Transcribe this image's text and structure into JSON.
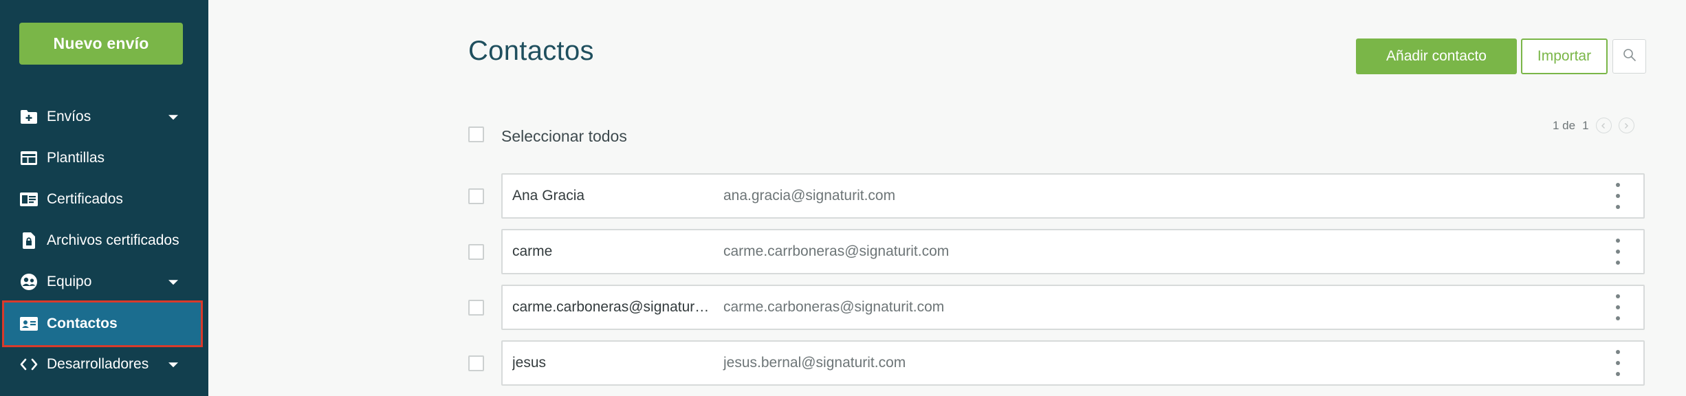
{
  "sidebar": {
    "new_button": "Nuevo envío",
    "items": [
      {
        "label": "Envíos",
        "icon": "folder-plus-icon",
        "has_caret": true
      },
      {
        "label": "Plantillas",
        "icon": "template-icon",
        "has_caret": false
      },
      {
        "label": "Certificados",
        "icon": "certificate-icon",
        "has_caret": false
      },
      {
        "label": "Archivos certificados",
        "icon": "locked-file-icon",
        "has_caret": false
      },
      {
        "label": "Equipo",
        "icon": "team-icon",
        "has_caret": true
      },
      {
        "label": "Contactos",
        "icon": "contact-card-icon",
        "has_caret": false,
        "active": true
      },
      {
        "label": "Desarrolladores",
        "icon": "code-icon",
        "has_caret": true
      }
    ]
  },
  "header": {
    "title": "Contactos",
    "add_button": "Añadir contacto",
    "import_button": "Importar"
  },
  "list": {
    "select_all_label": "Seleccionar todos",
    "pager": {
      "current": "1 de",
      "total": "1"
    },
    "rows": [
      {
        "name": "Ana Gracia",
        "email": "ana.gracia@signaturit.com"
      },
      {
        "name": "carme",
        "email": "carme.carrboneras@signaturit.com"
      },
      {
        "name": "carme.carboneras@signaturit.com",
        "email": "carme.carboneras@signaturit.com"
      },
      {
        "name": "jesus",
        "email": "jesus.bernal@signaturit.com"
      }
    ]
  },
  "colors": {
    "sidebar_bg": "#123f4e",
    "accent_green": "#7ab648",
    "active_item_bg": "#1b6d8f",
    "active_outline": "#d93a2b",
    "title_color": "#1f4f5e"
  }
}
